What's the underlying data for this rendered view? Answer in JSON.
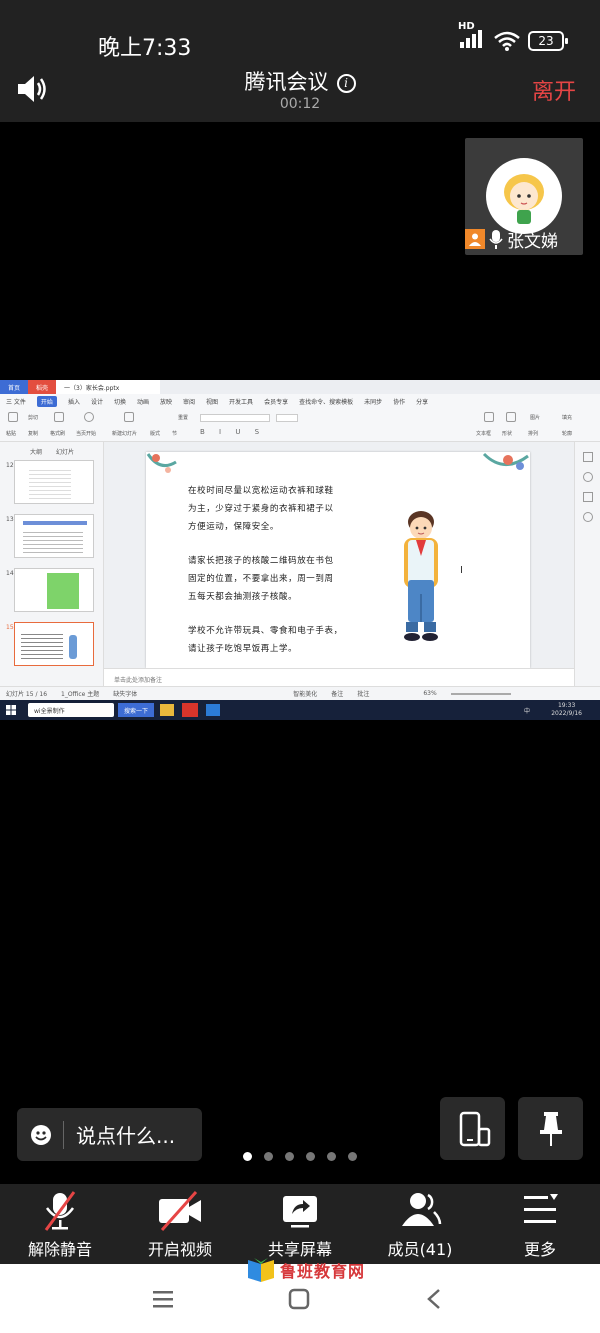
{
  "status": {
    "time": "晚上7:33",
    "network": "HD",
    "battery": "23"
  },
  "header": {
    "title": "腾讯会议",
    "timer": "00:12",
    "leave_label": "离开"
  },
  "participant": {
    "name": "张文娣"
  },
  "shared_screen": {
    "tabs": [
      "首页",
      "稻壳",
      "一（3）家长会.pptx"
    ],
    "menu": [
      "三 文件",
      "开始",
      "插入",
      "设计",
      "切换",
      "动画",
      "放映",
      "审阅",
      "视图",
      "开发工具",
      "会员专享",
      "查找命令、搜索模板",
      "未同步",
      "协作",
      "分享"
    ],
    "active_menu": "开始",
    "ribbon": [
      "粘贴",
      "剪切",
      "复制",
      "格式刷",
      "当页开始",
      "新建幻灯片",
      "版式",
      "节",
      "重置",
      "文本框",
      "形状",
      "排列",
      "图片",
      "填充",
      "轮廓"
    ],
    "pane_tabs": [
      "大纲",
      "幻灯片"
    ],
    "slide_numbers": [
      "12",
      "13",
      "14",
      "15"
    ],
    "slide_lines": [
      "在校时间尽量以宽松运动衣裤和球鞋",
      "为主，少穿过于紧身的衣裤和裙子以",
      "方便运动，保障安全。",
      "请家长把孩子的核酸二维码放在书包",
      "固定的位置，不要拿出来，周一到周",
      "五每天都会抽测孩子核酸。",
      "学校不允许带玩具、零食和电子手表，",
      "请让孩子吃饱早饭再上学。"
    ],
    "notes_placeholder": "单击此处添加备注",
    "status_items": [
      "幻灯片 15 / 16",
      "1_Office 主题",
      "缺失字体"
    ],
    "status_right": [
      "智能美化",
      "备注",
      "批注",
      "63%"
    ],
    "taskbar_search": "wi全景制作",
    "taskbar_tab": "搜索一下",
    "clock_time": "19:33",
    "clock_date": "2022/9/16",
    "ime": "中"
  },
  "chat": {
    "placeholder": "说点什么..."
  },
  "pager": {
    "count": 6,
    "active": 1
  },
  "toolbar": {
    "unmute": "解除静音",
    "video": "开启视频",
    "share": "共享屏幕",
    "members": "成员(41)",
    "more": "更多"
  },
  "watermark": "鲁班教育网",
  "colors": {
    "leave": "#e64545",
    "background": "#000000",
    "bar": "#222222",
    "wps_accent": "#3d6cd4"
  }
}
